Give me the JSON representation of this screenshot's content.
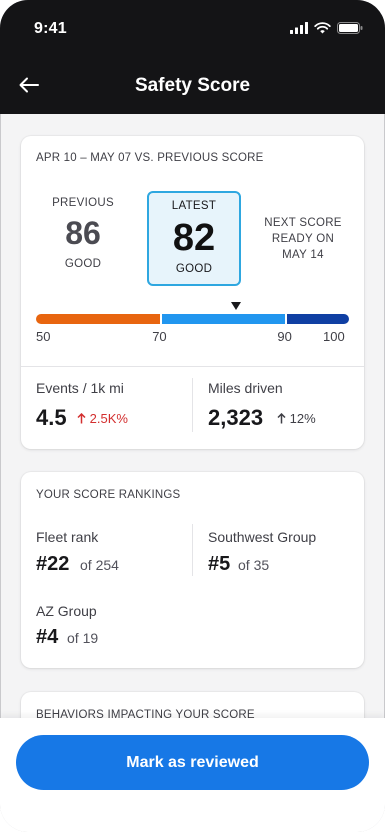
{
  "status_bar": {
    "time": "9:41",
    "icons": [
      "signal-icon",
      "wifi-icon",
      "battery-icon"
    ]
  },
  "header": {
    "title": "Safety Score",
    "back_icon": "back-arrow-icon"
  },
  "score_card": {
    "title": "APR 10 – MAY 07 VS. PREVIOUS SCORE",
    "previous": {
      "label": "PREVIOUS",
      "value": "86",
      "rating": "GOOD"
    },
    "latest": {
      "label": "LATEST",
      "value": "82",
      "rating": "GOOD"
    },
    "next": {
      "line1": "NEXT SCORE",
      "line2": "READY ON",
      "line3": "MAY 14"
    },
    "scale": {
      "ticks": [
        "50",
        "70",
        "90",
        "100"
      ],
      "segments": [
        {
          "from": 50,
          "to": 70,
          "color": "#e8650f"
        },
        {
          "from": 70,
          "to": 90,
          "color": "#2196ef"
        },
        {
          "from": 90,
          "to": 100,
          "color": "#0f3fa3"
        }
      ],
      "marker_value": 82
    },
    "events": {
      "label": "Events / 1k mi",
      "value": "4.5",
      "delta": "2.5K%",
      "delta_color": "#d32f2f"
    },
    "miles": {
      "label": "Miles driven",
      "value": "2,323",
      "delta": "12%",
      "delta_color": "#3f3f46"
    }
  },
  "rankings_card": {
    "title": "YOUR SCORE RANKINGS",
    "fleet": {
      "label": "Fleet rank",
      "rank": "#22",
      "of": "of 254"
    },
    "southwest": {
      "label": "Southwest Group",
      "rank": "#5",
      "of": "of 35"
    },
    "az": {
      "label": "AZ Group",
      "rank": "#4",
      "of": "of 19"
    }
  },
  "behaviors_card": {
    "title": "BEHAVIORS IMPACTING YOUR SCORE"
  },
  "footer": {
    "button_label": "Mark as reviewed",
    "button_color": "#1778e6"
  }
}
